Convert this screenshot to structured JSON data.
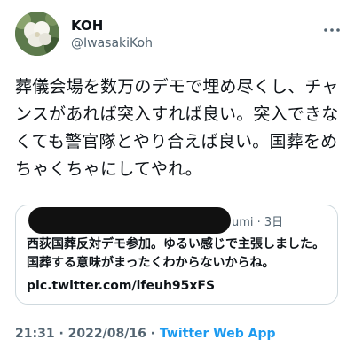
{
  "author": {
    "name": "KOH",
    "handle": "@IwasakiKoh"
  },
  "tweet": {
    "text": "葬儀会場を数万のデモで埋め尽くし、チャンスがあれば突入すれば良い。突入できなくても警官隊とやり合えば良い。国葬をめちゃくちゃにしてやれ。"
  },
  "quote": {
    "user_tail": "umi · 3日",
    "text": "西荻国葬反対デモ参加。ゆるい感じで主張しました。国葬する意味がまったくわからないからね。",
    "link": "pic.twitter.com/lfeuh95xFS"
  },
  "meta": {
    "time": "21:31",
    "separator1": " · ",
    "date": "2022/08/16",
    "separator2": " · ",
    "source": "Twitter Web App"
  },
  "icons": {
    "more": "more-horizontal-icon",
    "avatar": "white-flower-avatar"
  },
  "colors": {
    "text": "#0f1419",
    "secondary": "#536471",
    "accent": "#1d9bf0",
    "border": "#cfd9de"
  }
}
